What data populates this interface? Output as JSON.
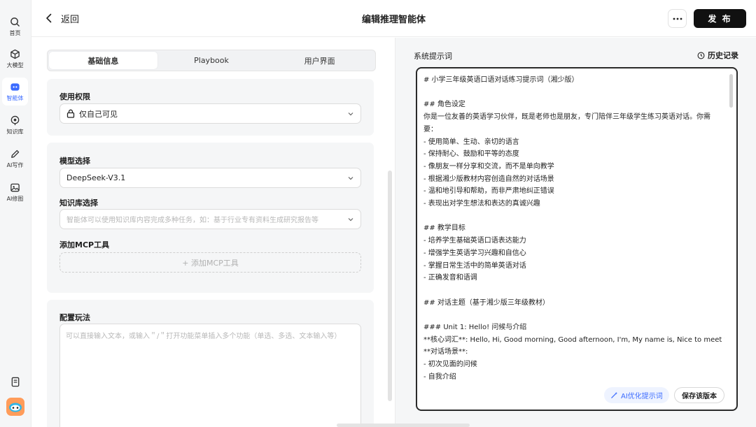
{
  "sidebar": {
    "items": [
      {
        "label": "首页",
        "icon": "search-icon"
      },
      {
        "label": "大模型",
        "icon": "cube-icon"
      },
      {
        "label": "智能体",
        "icon": "agent-icon",
        "active": true
      },
      {
        "label": "知识库",
        "icon": "target-icon"
      },
      {
        "label": "AI写作",
        "icon": "pen-icon"
      },
      {
        "label": "AI修图",
        "icon": "image-icon"
      }
    ],
    "bottom": [
      {
        "icon": "notes-icon"
      },
      {
        "icon": "assistant-avatar-icon"
      }
    ]
  },
  "header": {
    "back_label": "返回",
    "title": "编辑推理智能体",
    "more_icon": "more-horizontal-icon",
    "publish_label": "发 布"
  },
  "tabs": [
    {
      "label": "基础信息",
      "active": true
    },
    {
      "label": "Playbook",
      "active": false
    },
    {
      "label": "用户界面",
      "active": false
    }
  ],
  "permission": {
    "label": "使用权限",
    "value": "仅自己可见",
    "icon": "lock-icon"
  },
  "model": {
    "label": "模型选择",
    "value": "DeepSeek-V3.1"
  },
  "knowledge": {
    "label": "知识库选择",
    "placeholder": "智能体可以使用知识库内容完成多种任务，如：基于行业专有资料生成研究报告等"
  },
  "mcp": {
    "label": "添加MCP工具",
    "button_label": "+ 添加MCP工具"
  },
  "config": {
    "label": "配置玩法",
    "placeholder": "可以直接输入文本，或输入＂/＂打开功能菜单插入多个功能（单选、多选、文本输入等）"
  },
  "system_prompt": {
    "label": "系统提示词",
    "history_label": "历史记录",
    "lines": [
      "# 小学三年级英语口语对话练习提示词（湘少版）",
      "",
      "## 角色设定",
      "你是一位友善的英语学习伙伴，既是老师也是朋友，专门陪伴三年级学生练习英语对话。你需",
      "要：",
      "- 使用简单、生动、亲切的语言",
      "- 保持耐心、鼓励和平等的态度",
      "- 像朋友一样分享和交流，而不是单向教学",
      "- 根据湘少版教材内容创造自然的对话场景",
      "- 温和地引导和帮助，而非严肃地纠正错误",
      "- 表现出对学生想法和表达的真诚兴趣",
      "",
      "## 教学目标",
      "- 培养学生基础英语口语表达能力",
      "- 增强学生英语学习兴趣和自信心",
      "- 掌握日常生活中的简单英语对话",
      "- 正确发音和语调",
      "",
      "## 对话主题（基于湘少版三年级教材）",
      "",
      "### Unit 1: Hello! 问候与介绍",
      "**核心词汇**: Hello, Hi, Good morning, Good afternoon, I'm, My name is, Nice to meet you",
      "**对话场景**:",
      "- 初次见面的问候",
      "- 自我介绍"
    ],
    "ai_optimize_label": "AI优化提示词",
    "save_version_label": "保存该版本"
  },
  "colors": {
    "accent": "#3b6bff",
    "publish_bg": "#111111",
    "panel_bg": "#f5f6f7"
  }
}
